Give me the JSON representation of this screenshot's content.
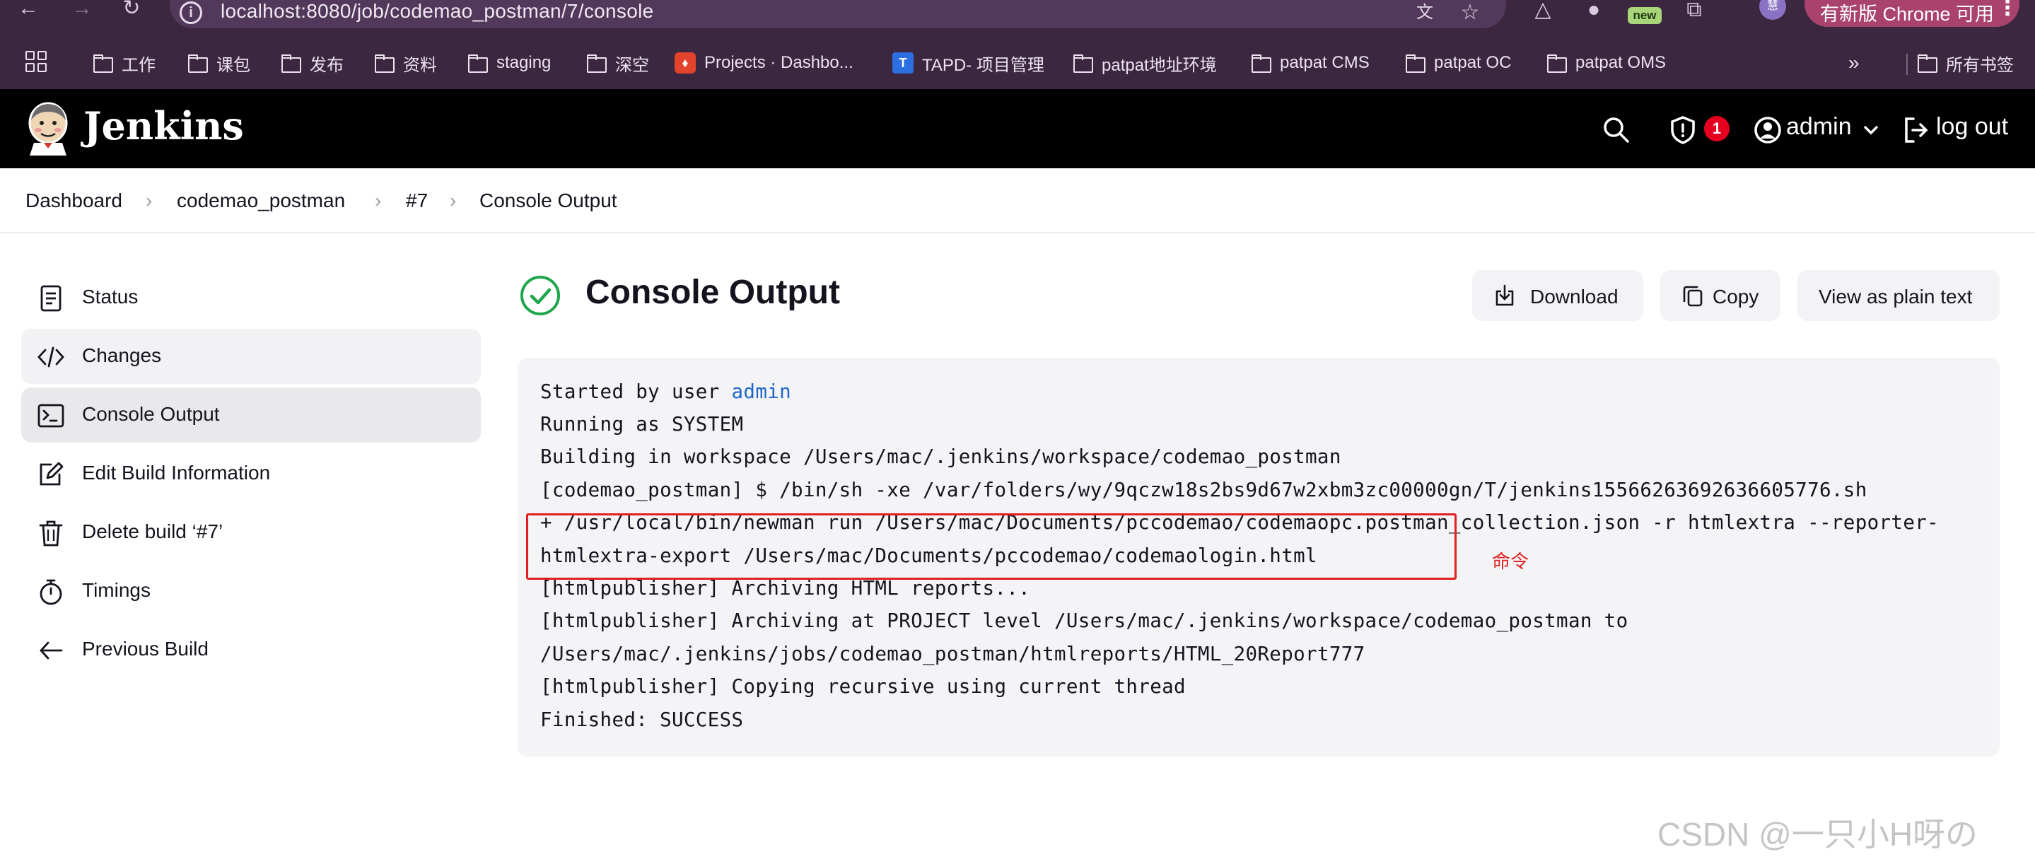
{
  "browser": {
    "url": "localhost:8080/job/codemao_postman/7/console",
    "new_badge": "new",
    "profile_initial": "慧",
    "update_chip": "有新版 Chrome 可用",
    "bookmarks": [
      {
        "label": "工作",
        "icon": "folder-icon"
      },
      {
        "label": "课包",
        "icon": "folder-icon"
      },
      {
        "label": "发布",
        "icon": "folder-icon"
      },
      {
        "label": "资料",
        "icon": "folder-icon"
      },
      {
        "label": "staging",
        "icon": "folder-icon"
      },
      {
        "label": "深空",
        "icon": "folder-icon"
      },
      {
        "label": "Projects · Dashbo...",
        "icon": "gitlab-icon"
      },
      {
        "label": "TAPD- 项目管理",
        "icon": "tapd-icon"
      },
      {
        "label": "patpat地址环境",
        "icon": "folder-icon"
      },
      {
        "label": "patpat CMS",
        "icon": "folder-icon"
      },
      {
        "label": "patpat OC",
        "icon": "folder-icon"
      },
      {
        "label": "patpat OMS",
        "icon": "folder-icon"
      }
    ],
    "all_bookmarks": "所有书签",
    "colors": {
      "chrome_bg": "#3b2740",
      "omnibox_bg": "#52395b",
      "update_chip": "#a9436e"
    }
  },
  "header": {
    "brand": "Jenkins",
    "security_count": "1",
    "user": "admin",
    "logout": "log out"
  },
  "breadcrumb": [
    "Dashboard",
    "codemao_postman",
    "#7",
    "Console Output"
  ],
  "sidebar": [
    {
      "label": "Status",
      "icon": "status-document-icon"
    },
    {
      "label": "Changes",
      "icon": "code-icon"
    },
    {
      "label": "Console Output",
      "icon": "terminal-icon"
    },
    {
      "label": "Edit Build Information",
      "icon": "edit-icon"
    },
    {
      "label": "Delete build ‘#7’",
      "icon": "trash-icon"
    },
    {
      "label": "Timings",
      "icon": "stopwatch-icon"
    },
    {
      "label": "Previous Build",
      "icon": "arrow-left-icon"
    }
  ],
  "main": {
    "title": "Console Output",
    "status": "success",
    "actions": {
      "download": "Download",
      "copy": "Copy",
      "plain_text": "View as plain text"
    },
    "console": {
      "started_prefix": "Started by user ",
      "started_user": "admin",
      "lines": [
        "Running as SYSTEM",
        "Building in workspace /Users/mac/.jenkins/workspace/codemao_postman",
        "[codemao_postman] $ /bin/sh -xe /var/folders/wy/9qczw18s2bs9d67w2xbm3zc00000gn/T/jenkins15566263692636605776.sh",
        "+ /usr/local/bin/newman run /Users/mac/Documents/pccodemao/codemaopc.postman_collection.json -r htmlextra --reporter-",
        "htmlextra-export /Users/mac/Documents/pccodemao/codemaologin.html",
        "[htmlpublisher] Archiving HTML reports...",
        "[htmlpublisher] Archiving at PROJECT level /Users/mac/.jenkins/workspace/codemao_postman to",
        "/Users/mac/.jenkins/jobs/codemao_postman/htmlreports/HTML_20Report777",
        "[htmlpublisher] Copying recursive using current thread",
        "Finished: SUCCESS"
      ]
    },
    "annotation_note": "命令",
    "colors": {
      "success": "#1ea64b",
      "link": "#1f68c9",
      "annotation": "#e02020"
    }
  },
  "watermark": "CSDN @一只小H呀の"
}
